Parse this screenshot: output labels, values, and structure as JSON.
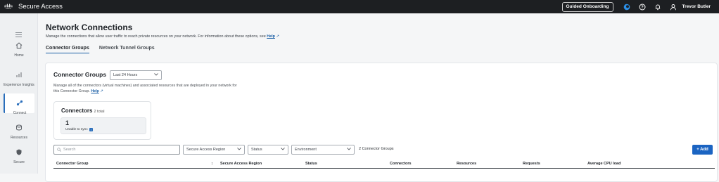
{
  "topbar": {
    "brand_text": "cisco",
    "app_title": "Secure Access",
    "guided_label": "Guided Onboarding",
    "user_name": "Trevor Butler",
    "accent": "#1b64c2"
  },
  "sidebar": {
    "items": [
      {
        "label": "Home",
        "icon": "home-icon"
      },
      {
        "label": "Experience Insights",
        "icon": "insights-icon"
      },
      {
        "label": "Connect",
        "icon": "connect-icon",
        "active": true
      },
      {
        "label": "Resources",
        "icon": "resources-icon"
      },
      {
        "label": "Secure",
        "icon": "shield-icon"
      }
    ]
  },
  "page": {
    "title": "Network Connections",
    "description": "Manage the connections that allow user traffic to reach private resources on your network. For information about these options, see",
    "help_link": "Help",
    "tabs": [
      {
        "label": "Connector Groups",
        "active": true
      },
      {
        "label": "Network Tunnel Groups",
        "active": false
      }
    ]
  },
  "panel": {
    "title": "Connector Groups",
    "time_range": "Last 24 Hours",
    "description": "Manage all of the connectors (virtual machines) and associated resources that are deployed in your network for this Connector Group.",
    "help_link": "Help",
    "connectors_card": {
      "title": "Connectors",
      "total": "2 total",
      "count": "1",
      "status": "Unable to sync",
      "badge": "i"
    },
    "filters": {
      "search_placeholder": "Search",
      "region": "Secure Access Region",
      "status": "Status",
      "environment": "Environment",
      "count_text": "2 Connector Groups"
    },
    "add_label": "+ Add",
    "columns": [
      "Connector Group",
      "Secure Access Region",
      "Status",
      "Connectors",
      "Resources",
      "Requests",
      "Average CPU load"
    ]
  }
}
